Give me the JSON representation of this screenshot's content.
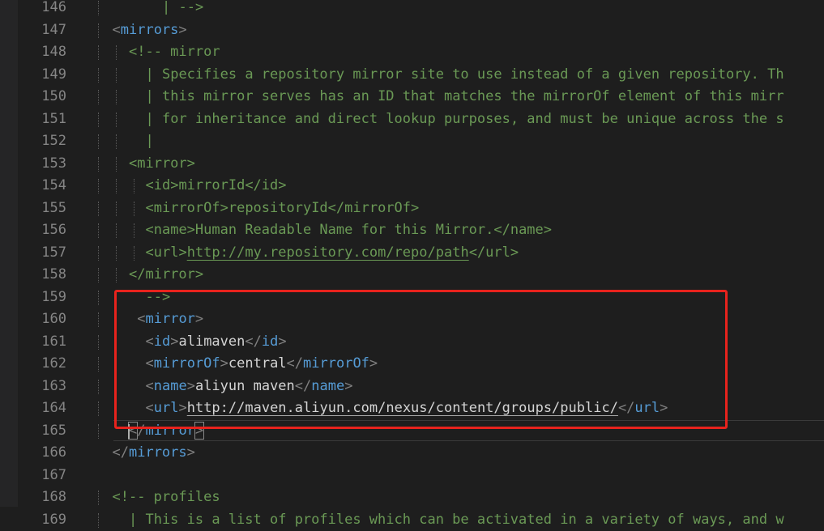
{
  "editor": {
    "lines": [
      {
        "n": "146",
        "text": "| -->"
      },
      {
        "n": "147",
        "text": "<mirrors>"
      },
      {
        "n": "148",
        "text": "<!-- mirror"
      },
      {
        "n": "149",
        "text": "| Specifies a repository mirror site to use instead of a given repository. Th"
      },
      {
        "n": "150",
        "text": "| this mirror serves has an ID that matches the mirrorOf element of this mirr"
      },
      {
        "n": "151",
        "text": "| for inheritance and direct lookup purposes, and must be unique across the s"
      },
      {
        "n": "152",
        "text": "|"
      },
      {
        "n": "153",
        "text": "<mirror>"
      },
      {
        "n": "154",
        "text": "<id>mirrorId</id>"
      },
      {
        "n": "155",
        "text": "<mirrorOf>repositoryId</mirrorOf>"
      },
      {
        "n": "156",
        "text": "<name>Human Readable Name for this Mirror.</name>"
      },
      {
        "n": "157",
        "text": "<url>http://my.repository.com/repo/path</url>"
      },
      {
        "n": "158",
        "text": "</mirror>"
      },
      {
        "n": "159",
        "text": "-->"
      },
      {
        "n": "160",
        "text": "<mirror>"
      },
      {
        "n": "161",
        "text": "<id>alimaven</id>"
      },
      {
        "n": "162",
        "text": "<mirrorOf>central</mirrorOf>"
      },
      {
        "n": "163",
        "text": "<name>aliyun maven</name>"
      },
      {
        "n": "164",
        "text": "<url>http://maven.aliyun.com/nexus/content/groups/public/</url>"
      },
      {
        "n": "165",
        "text": "</mirror>"
      },
      {
        "n": "166",
        "text": "</mirrors>"
      },
      {
        "n": "167",
        "text": ""
      },
      {
        "n": "168",
        "text": "<!-- profiles"
      },
      {
        "n": "169",
        "text": "| This is a list of profiles which can be activated in a variety of ways, and w"
      }
    ]
  },
  "colors": {
    "background": "#1e1e1e",
    "tag": "#569cd6",
    "comment": "#6a9955",
    "text": "#d4d4d4",
    "line_number": "#858585",
    "annotation_box": "#e8231d"
  }
}
